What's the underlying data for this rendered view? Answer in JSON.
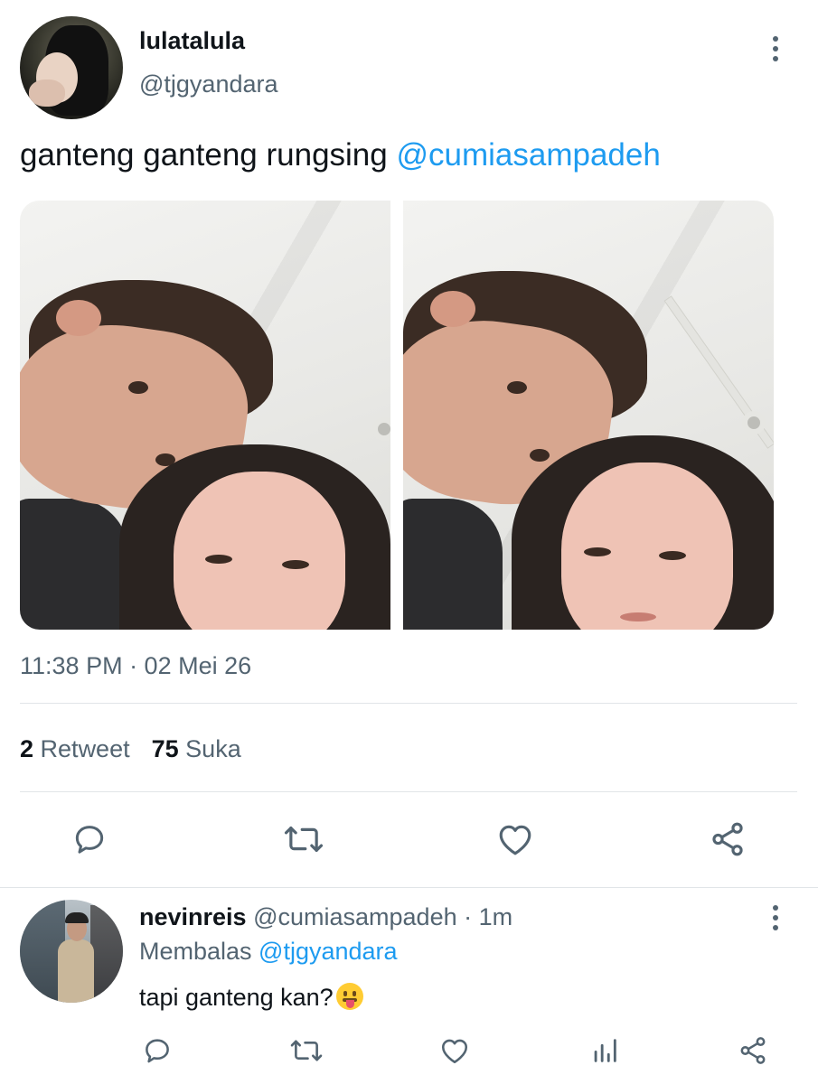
{
  "tweet": {
    "display_name": "lulatalula",
    "handle": "@tjgyandara",
    "text": "ganteng ganteng rungsing ",
    "mention": "@cumiasampadeh",
    "timestamp": "11:38 PM · 02 Mei 26",
    "retweet_count": "2",
    "retweet_label": "Retweet",
    "like_count": "75",
    "like_label": "Suka",
    "media_count": 2
  },
  "reply": {
    "display_name": "nevinreis",
    "handle_time": "@cumiasampadeh · 1m",
    "replying_prefix": "Membalas ",
    "replying_to": "@tjgyandara",
    "text": "tapi ganteng kan?"
  },
  "icons": {
    "more": "more-vertical-icon",
    "reply": "comment-icon",
    "retweet": "retweet-icon",
    "like": "heart-icon",
    "share": "share-icon",
    "analytics": "analytics-icon"
  },
  "colors": {
    "accent": "#1d9bf0",
    "text_primary": "#0f1419",
    "text_secondary": "#536471",
    "divider": "#e1e5e8"
  }
}
